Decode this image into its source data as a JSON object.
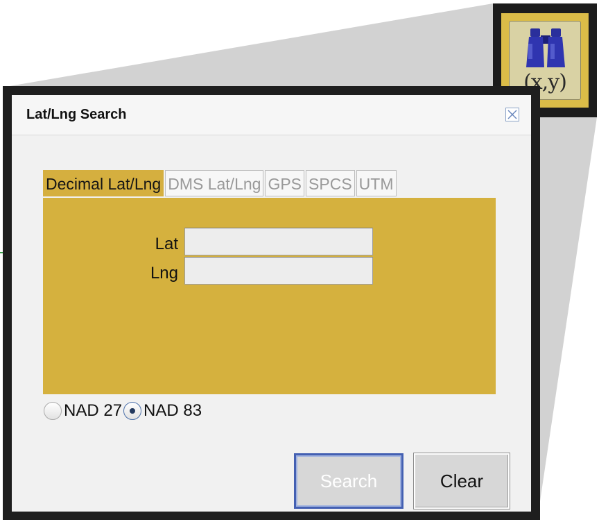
{
  "toolbar_button": {
    "icon": "binoculars-icon",
    "label": "(x,y)"
  },
  "dialog": {
    "title": "Lat/Lng Search",
    "close_icon": "close-icon"
  },
  "tabs": [
    {
      "label": "Decimal Lat/Lng",
      "active": true
    },
    {
      "label": "DMS Lat/Lng",
      "active": false
    },
    {
      "label": "GPS",
      "active": false
    },
    {
      "label": "SPCS",
      "active": false
    },
    {
      "label": "UTM",
      "active": false
    }
  ],
  "fields": {
    "lat": {
      "label": "Lat",
      "value": ""
    },
    "lng": {
      "label": "Lng",
      "value": ""
    }
  },
  "datum": {
    "options": [
      {
        "label": "NAD 27",
        "checked": false
      },
      {
        "label": "NAD 83",
        "checked": true
      }
    ]
  },
  "buttons": {
    "search": "Search",
    "clear": "Clear"
  },
  "colors": {
    "accent": "#d5af3f",
    "callout_line": "#3aa24a",
    "dialog_frame": "#1e1e1e"
  }
}
